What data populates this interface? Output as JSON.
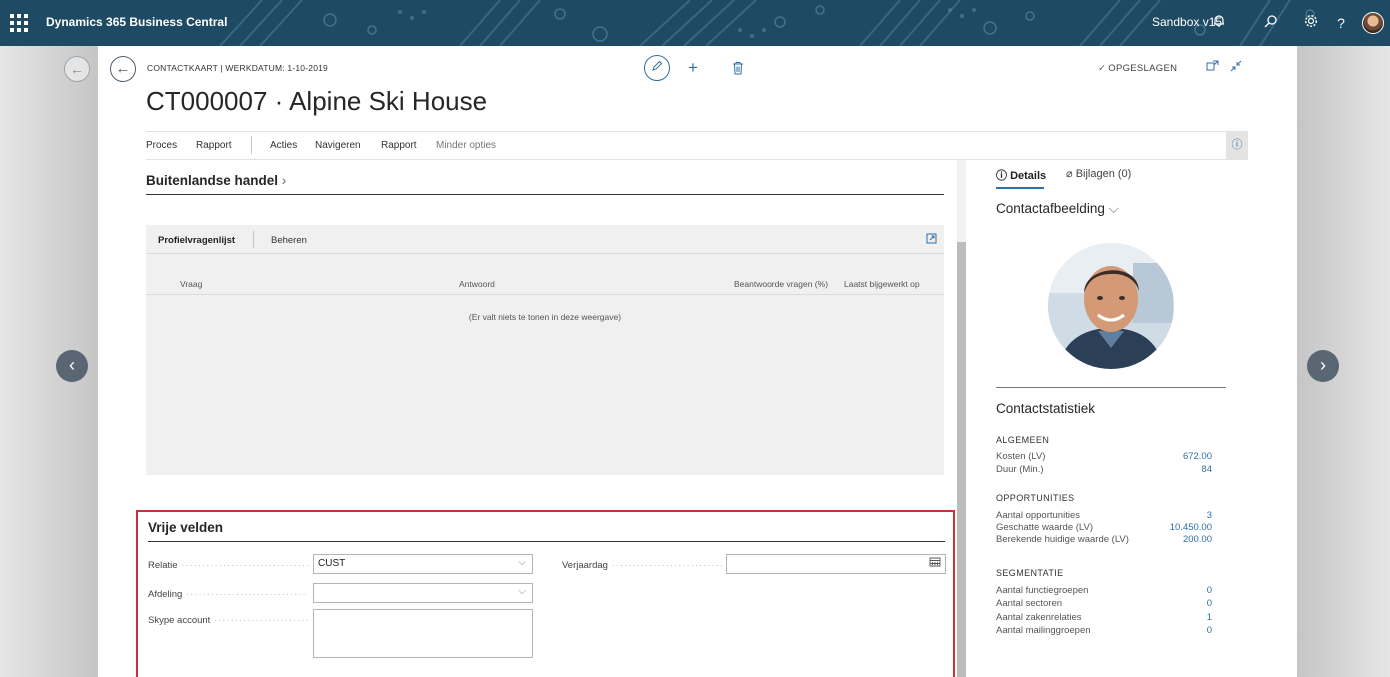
{
  "topbar": {
    "app_title": "Dynamics 365 Business Central",
    "company": "Sandbox v15",
    "icons": [
      "waffle-icon",
      "bell-icon",
      "search-icon",
      "gear-icon",
      "help-icon",
      "user-avatar"
    ]
  },
  "header": {
    "caption": "CONTACTKAART | WERKDATUM: 1-10-2019",
    "title": "CT000007 · Alpine Ski House",
    "saved_status": "OPGESLAGEN"
  },
  "action_bar": {
    "items": [
      "Proces",
      "Rapport",
      "Acties",
      "Navigeren",
      "Rapport",
      "Minder opties"
    ]
  },
  "foreign_trade": {
    "heading": "Buitenlandse handel"
  },
  "profile_part": {
    "tabs": [
      "Profielvragenlijst",
      "Beheren"
    ],
    "columns": [
      "Vraag",
      "Antwoord",
      "Beantwoorde vragen (%)",
      "Laatst bijgewerkt op"
    ],
    "empty_message": "(Er valt niets te tonen in deze weergave)"
  },
  "free_fields": {
    "heading": "Vrije velden",
    "relatie_label": "Relatie",
    "relatie_value": "CUST",
    "afdeling_label": "Afdeling",
    "afdeling_value": "",
    "skype_label": "Skype account",
    "skype_value": "",
    "verjaardag_label": "Verjaardag",
    "verjaardag_value": ""
  },
  "factbox": {
    "tab_details": "Details",
    "tab_attachments": "Bijlagen (0)",
    "picture_heading": "Contactafbeelding",
    "stats_heading": "Contactstatistiek",
    "groups": [
      {
        "title": "ALGEMEEN",
        "rows": [
          {
            "label": "Kosten (LV)",
            "value": "672.00"
          },
          {
            "label": "Duur (Min.)",
            "value": "84"
          }
        ]
      },
      {
        "title": "OPPORTUNITIES",
        "rows": [
          {
            "label": "Aantal opportunities",
            "value": "3"
          },
          {
            "label": "Geschatte waarde (LV)",
            "value": "10.450.00"
          },
          {
            "label": "Berekende huidige waarde (LV)",
            "value": "200.00"
          }
        ]
      },
      {
        "title": "SEGMENTATIE",
        "rows": [
          {
            "label": "Aantal functiegroepen",
            "value": "0"
          },
          {
            "label": "Aantal sectoren",
            "value": "0"
          },
          {
            "label": "Aantal zakenrelaties",
            "value": "1"
          },
          {
            "label": "Aantal mailinggroepen",
            "value": "0"
          }
        ]
      }
    ]
  },
  "colors": {
    "topbar": "#1f4a63",
    "accent": "#2f6fa5",
    "highlight_border": "#c6313c"
  }
}
